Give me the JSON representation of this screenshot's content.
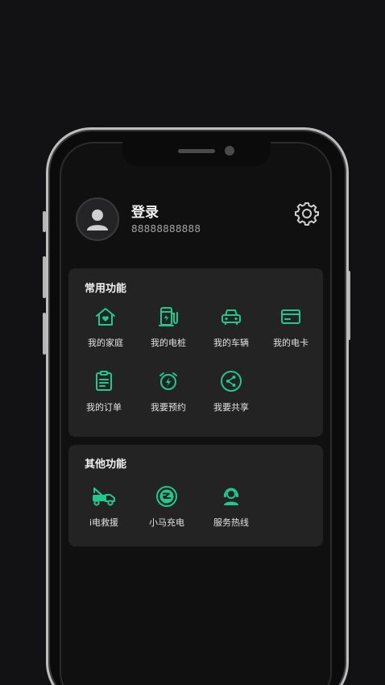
{
  "profile": {
    "title": "登录",
    "phone": "88888888888"
  },
  "common_functions": {
    "title": "常用功能",
    "items": [
      {
        "label": "我的家庭",
        "icon": "home-heart-icon"
      },
      {
        "label": "我的电桩",
        "icon": "charging-pile-icon"
      },
      {
        "label": "我的车辆",
        "icon": "car-icon"
      },
      {
        "label": "我的电卡",
        "icon": "card-icon"
      },
      {
        "label": "我的订单",
        "icon": "order-list-icon"
      },
      {
        "label": "我要预约",
        "icon": "alarm-clock-icon"
      },
      {
        "label": "我要共享",
        "icon": "share-icon"
      }
    ]
  },
  "other_functions": {
    "title": "其他功能",
    "items": [
      {
        "label": "i电救援",
        "icon": "tow-truck-icon"
      },
      {
        "label": "小马充电",
        "icon": "pony-charge-logo-icon"
      },
      {
        "label": "服务热线",
        "icon": "headset-agent-icon"
      }
    ]
  },
  "colors": {
    "accent": "#1fc88d",
    "background": "#101011",
    "card": "#232324"
  }
}
